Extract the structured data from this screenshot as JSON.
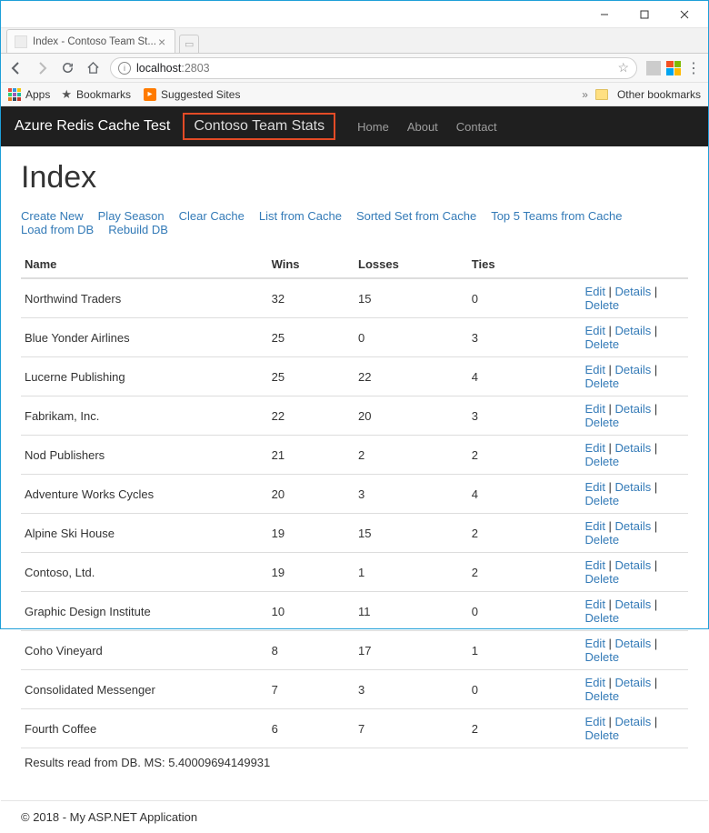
{
  "window": {
    "tab_title": "Index - Contoso Team St..."
  },
  "addressbar": {
    "host": "localhost",
    "port": ":2803"
  },
  "bookmarks": {
    "apps_label": "Apps",
    "bookmarks_label": "Bookmarks",
    "suggested_label": "Suggested Sites",
    "other_label": "Other bookmarks"
  },
  "appnav": {
    "brand": "Azure Redis Cache Test",
    "highlighted": "Contoso Team Stats",
    "links": [
      "Home",
      "About",
      "Contact"
    ]
  },
  "page": {
    "title": "Index",
    "actions": [
      "Create New",
      "Play Season",
      "Clear Cache",
      "List from Cache",
      "Sorted Set from Cache",
      "Top 5 Teams from Cache",
      "Load from DB",
      "Rebuild DB"
    ],
    "columns": {
      "name": "Name",
      "wins": "Wins",
      "losses": "Losses",
      "ties": "Ties"
    },
    "row_actions": {
      "edit": "Edit",
      "details": "Details",
      "delete": "Delete"
    },
    "rows": [
      {
        "name": "Northwind Traders",
        "wins": "32",
        "losses": "15",
        "ties": "0"
      },
      {
        "name": "Blue Yonder Airlines",
        "wins": "25",
        "losses": "0",
        "ties": "3"
      },
      {
        "name": "Lucerne Publishing",
        "wins": "25",
        "losses": "22",
        "ties": "4"
      },
      {
        "name": "Fabrikam, Inc.",
        "wins": "22",
        "losses": "20",
        "ties": "3"
      },
      {
        "name": "Nod Publishers",
        "wins": "21",
        "losses": "2",
        "ties": "2"
      },
      {
        "name": "Adventure Works Cycles",
        "wins": "20",
        "losses": "3",
        "ties": "4"
      },
      {
        "name": "Alpine Ski House",
        "wins": "19",
        "losses": "15",
        "ties": "2"
      },
      {
        "name": "Contoso, Ltd.",
        "wins": "19",
        "losses": "1",
        "ties": "2"
      },
      {
        "name": "Graphic Design Institute",
        "wins": "10",
        "losses": "11",
        "ties": "0"
      },
      {
        "name": "Coho Vineyard",
        "wins": "8",
        "losses": "17",
        "ties": "1"
      },
      {
        "name": "Consolidated Messenger",
        "wins": "7",
        "losses": "3",
        "ties": "0"
      },
      {
        "name": "Fourth Coffee",
        "wins": "6",
        "losses": "7",
        "ties": "2"
      }
    ],
    "status": "Results read from DB. MS: 5.40009694149931"
  },
  "footer": {
    "text": "© 2018 - My ASP.NET Application"
  }
}
